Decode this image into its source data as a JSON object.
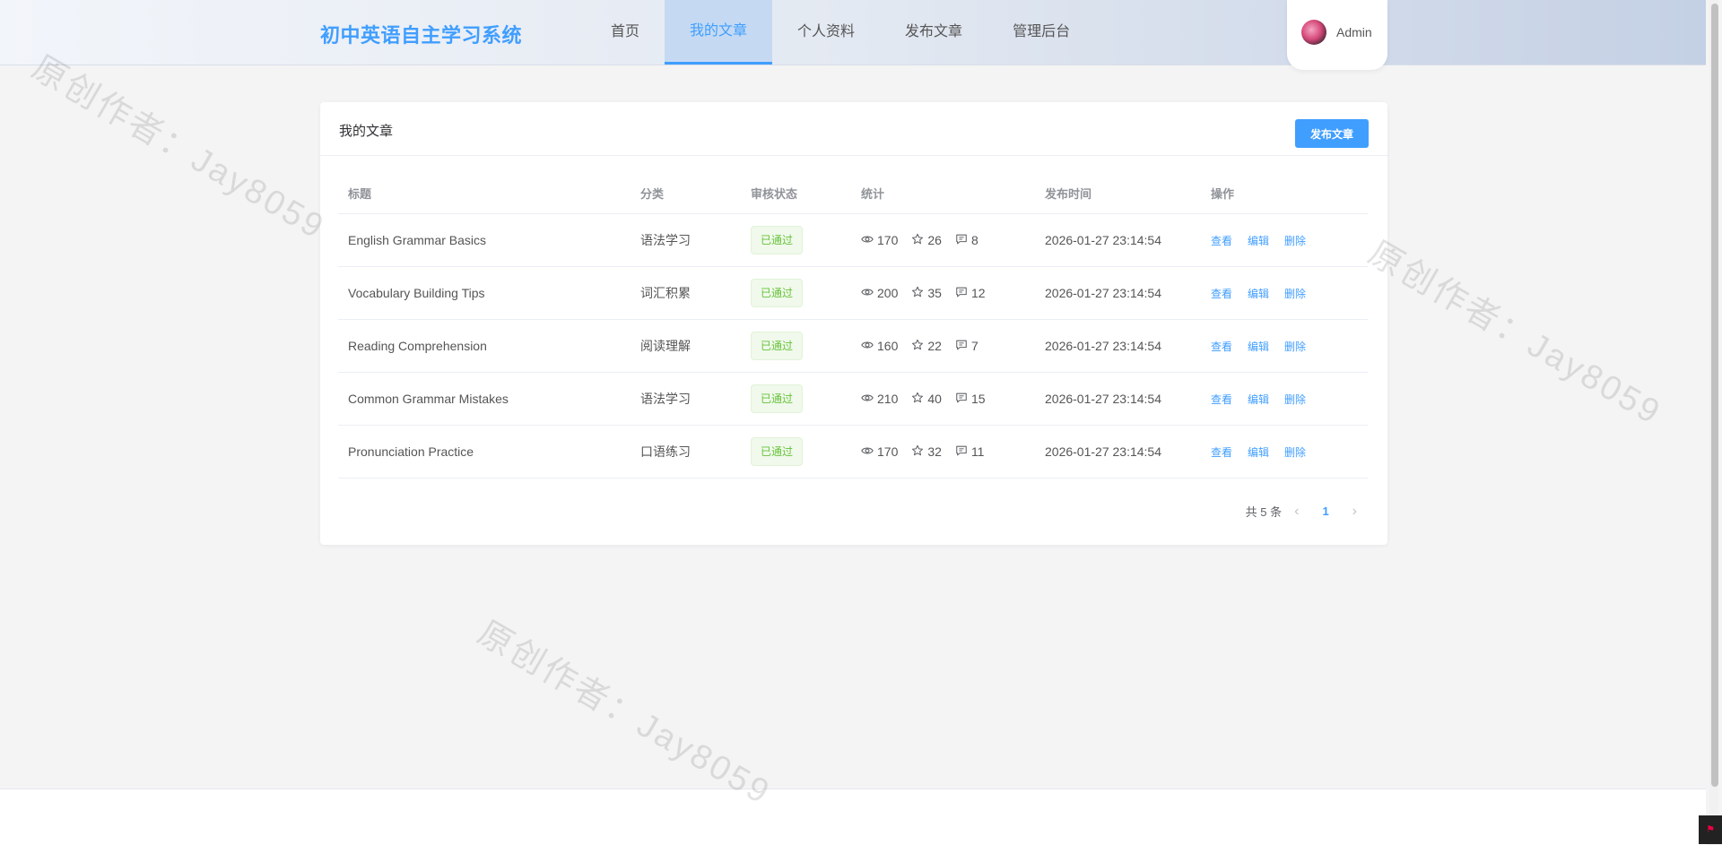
{
  "header": {
    "logo": "初中英语自主学习系统",
    "nav": [
      {
        "label": "首页",
        "active": false
      },
      {
        "label": "我的文章",
        "active": true
      },
      {
        "label": "个人资料",
        "active": false
      },
      {
        "label": "发布文章",
        "active": false
      },
      {
        "label": "管理后台",
        "active": false
      }
    ],
    "user": {
      "name": "Admin"
    }
  },
  "card": {
    "title": "我的文章",
    "publish_button": "发布文章",
    "columns": [
      "标题",
      "分类",
      "审核状态",
      "统计",
      "发布时间",
      "操作"
    ],
    "rows": [
      {
        "title": "English Grammar Basics",
        "category": "语法学习",
        "status": "已通过",
        "views": "170",
        "likes": "26",
        "comments": "8",
        "time": "2026-01-27 23:14:54"
      },
      {
        "title": "Vocabulary Building Tips",
        "category": "词汇积累",
        "status": "已通过",
        "views": "200",
        "likes": "35",
        "comments": "12",
        "time": "2026-01-27 23:14:54"
      },
      {
        "title": "Reading Comprehension",
        "category": "阅读理解",
        "status": "已通过",
        "views": "160",
        "likes": "22",
        "comments": "7",
        "time": "2026-01-27 23:14:54"
      },
      {
        "title": "Common Grammar Mistakes",
        "category": "语法学习",
        "status": "已通过",
        "views": "210",
        "likes": "40",
        "comments": "15",
        "time": "2026-01-27 23:14:54"
      },
      {
        "title": "Pronunciation Practice",
        "category": "口语练习",
        "status": "已通过",
        "views": "170",
        "likes": "32",
        "comments": "11",
        "time": "2026-01-27 23:14:54"
      }
    ],
    "actions": {
      "view": "查看",
      "edit": "编辑",
      "delete": "删除"
    },
    "pagination": {
      "total": "共 5 条",
      "current": "1"
    }
  },
  "watermark": "原创作者：Jay8059",
  "icons": {
    "views": "eye-icon",
    "likes": "star-icon",
    "comments": "comment-icon",
    "prev": "chevron-left-icon",
    "next": "chevron-right-icon"
  },
  "colors": {
    "primary": "#409eff",
    "success": "#67c23a"
  }
}
